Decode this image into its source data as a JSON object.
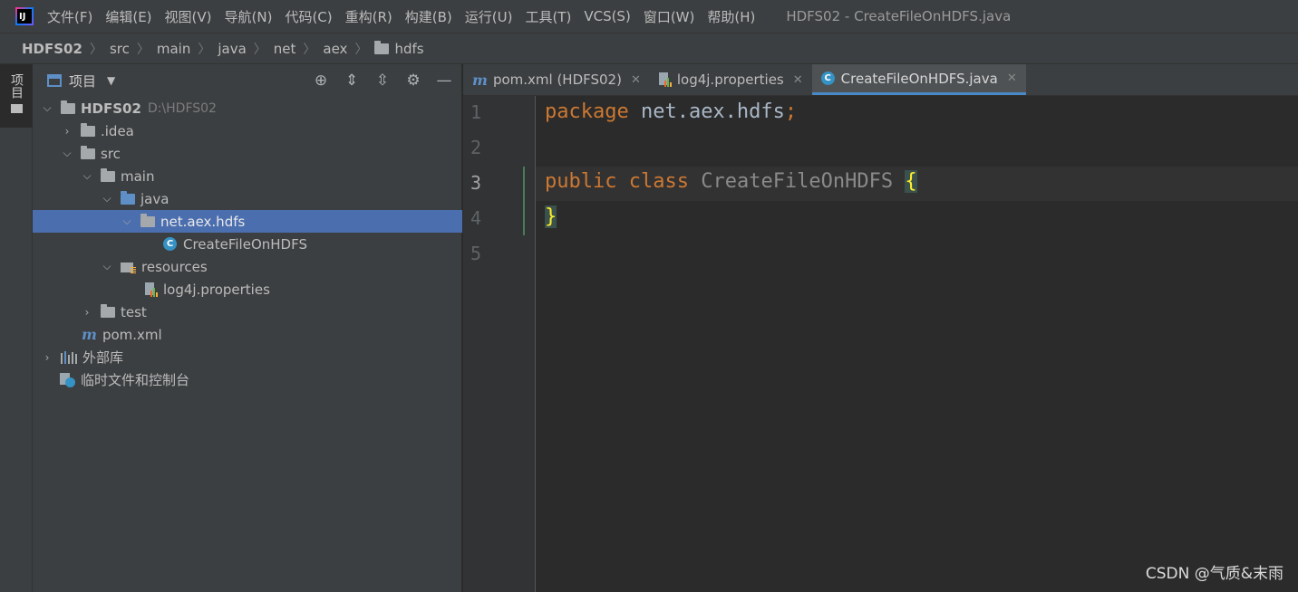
{
  "menubar": {
    "logo_text": "IJ",
    "items": [
      "文件(F)",
      "编辑(E)",
      "视图(V)",
      "导航(N)",
      "代码(C)",
      "重构(R)",
      "构建(B)",
      "运行(U)",
      "工具(T)",
      "VCS(S)",
      "窗口(W)",
      "帮助(H)"
    ],
    "window_title": "HDFS02 - CreateFileOnHDFS.java"
  },
  "breadcrumb": [
    "HDFS02",
    "src",
    "main",
    "java",
    "net",
    "aex",
    "hdfs"
  ],
  "tool_stripe": {
    "project_label": "项目"
  },
  "project_panel": {
    "title": "项目",
    "tools": [
      "locate-icon",
      "expand-all-icon",
      "collapse-all-icon",
      "gear-icon",
      "minimize-icon"
    ],
    "tree": [
      {
        "label": "HDFS02",
        "hint": "D:\\HDFS02",
        "icon": "module-folder-icon",
        "expanded": true
      },
      {
        "label": ".idea",
        "icon": "folder-icon",
        "expanded": false
      },
      {
        "label": "src",
        "icon": "folder-icon",
        "expanded": true
      },
      {
        "label": "main",
        "icon": "folder-icon",
        "expanded": true
      },
      {
        "label": "java",
        "icon": "source-folder-icon",
        "expanded": true
      },
      {
        "label": "net.aex.hdfs",
        "icon": "package-icon",
        "expanded": true,
        "selected": true
      },
      {
        "label": "CreateFileOnHDFS",
        "icon": "class-icon",
        "class_letter": "C"
      },
      {
        "label": "resources",
        "icon": "resources-folder-icon",
        "expanded": true
      },
      {
        "label": "log4j.properties",
        "icon": "properties-file-icon"
      },
      {
        "label": "test",
        "icon": "folder-icon",
        "expanded": false
      },
      {
        "label": "pom.xml",
        "icon": "maven-icon",
        "icon_glyph": "m"
      },
      {
        "label": "外部库",
        "icon": "libraries-icon",
        "expanded": false
      },
      {
        "label": "临时文件和控制台",
        "icon": "scratches-icon"
      }
    ]
  },
  "editor": {
    "tabs": [
      {
        "label": "pom.xml (HDFS02)",
        "icon": "maven-icon",
        "icon_glyph": "m",
        "active": false
      },
      {
        "label": "log4j.properties",
        "icon": "properties-file-icon",
        "active": false
      },
      {
        "label": "CreateFileOnHDFS.java",
        "icon": "class-icon",
        "icon_glyph": "C",
        "active": true
      }
    ],
    "close_glyph": "✕",
    "line_numbers": [
      "1",
      "2",
      "3",
      "4",
      "5"
    ],
    "current_line": "3",
    "code": {
      "line1": {
        "keyword": "package",
        "name": " net.aex.hdfs",
        "semicolon": ";"
      },
      "line3": {
        "kw1": "public",
        "kw2": "class",
        "class_name": "CreateFileOnHDFS",
        "open_brace": "{"
      },
      "line4": {
        "close_brace": "}"
      }
    }
  },
  "watermark": "CSDN @气质&末雨",
  "colors": {
    "keyword": "#cc7832",
    "selection": "#4b6eaf",
    "accent_tab": "#4a88c7",
    "brace_highlight": "#ffef28"
  }
}
